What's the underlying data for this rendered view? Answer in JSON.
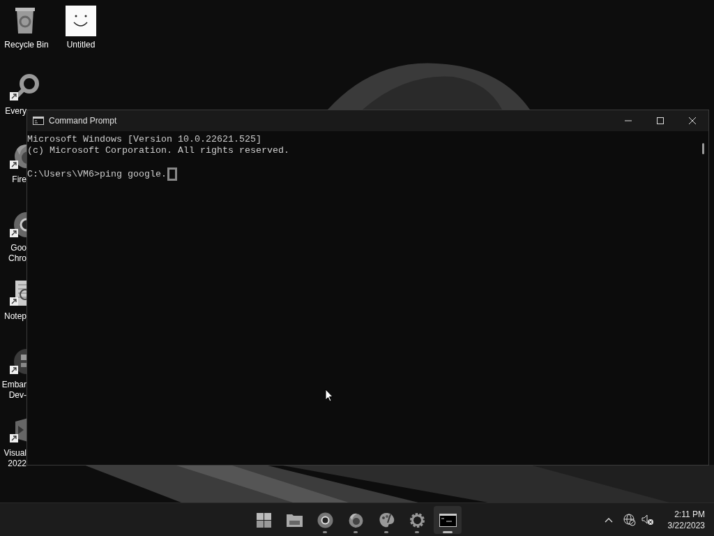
{
  "desktop": {
    "icons": [
      {
        "kind": "recycle",
        "label_lines": [
          "Recycle Bin"
        ]
      },
      {
        "label_lines": [
          "Untitled"
        ]
      }
    ],
    "partial_icons": [
      {
        "kind": "search",
        "label_lines": [
          "Every"
        ]
      },
      {
        "kind": "firefox",
        "label_lines": [
          "Fire"
        ]
      },
      {
        "kind": "chrome",
        "label_lines": [
          "Goo",
          "Chro"
        ]
      },
      {
        "kind": "notepad",
        "label_lines": [
          "Notep"
        ]
      },
      {
        "kind": "devcpp",
        "label_lines": [
          "Embar",
          "Dev-"
        ]
      },
      {
        "kind": "vs",
        "label_lines": [
          "Visual",
          "2022"
        ]
      }
    ]
  },
  "window": {
    "title": "Command Prompt",
    "lines": [
      "Microsoft Windows [Version 10.0.22621.525]",
      "(c) Microsoft Corporation. All rights reserved."
    ],
    "prompt": "C:\\Users\\VM6>ping google."
  },
  "taskbar": {
    "apps": [
      {
        "kind": "start",
        "running": false,
        "selected": false
      },
      {
        "kind": "folder",
        "running": false,
        "selected": false
      },
      {
        "kind": "chrome",
        "running": true,
        "selected": false
      },
      {
        "kind": "firefox",
        "running": true,
        "selected": false
      },
      {
        "kind": "paint",
        "running": true,
        "selected": false
      },
      {
        "kind": "settings",
        "running": true,
        "selected": false
      },
      {
        "kind": "terminal",
        "running": true,
        "selected": true
      }
    ],
    "time": "2:11 PM",
    "date": "3/22/2023"
  }
}
